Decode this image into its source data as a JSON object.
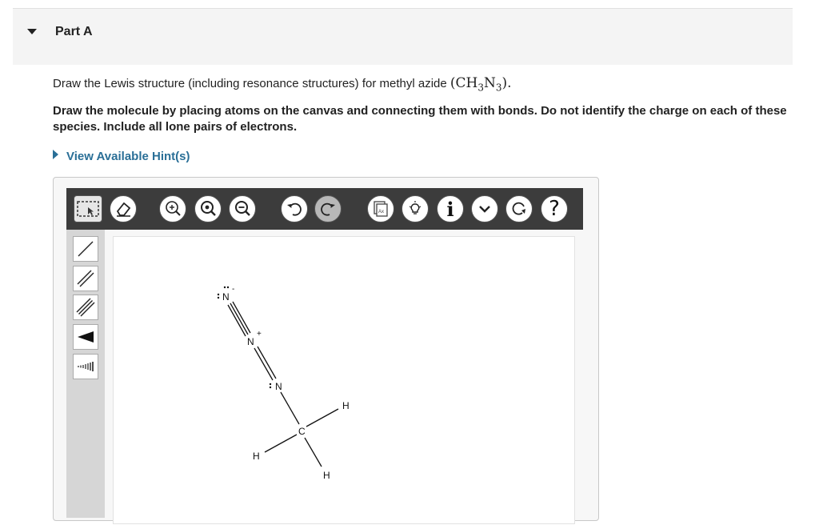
{
  "part": {
    "title": "Part A",
    "caret": "caret-down-icon"
  },
  "question": {
    "prompt_prefix": "Draw the Lewis structure (including resonance structures) for methyl azide ",
    "formula_open": "(CH",
    "formula_sub1": "3",
    "formula_mid": "N",
    "formula_sub2": "3",
    "formula_close": ").",
    "instructions": "Draw the molecule by placing atoms on the canvas and connecting them with bonds. Do not identify the charge on each of these species. Include all lone pairs of electrons.",
    "hint_label": "View Available Hint(s)"
  },
  "toolbar": {
    "buttons": [
      "select-icon",
      "eraser-icon",
      "zoom-fit-icon",
      "zoom-in-icon",
      "zoom-out-icon",
      "undo-icon",
      "redo-icon",
      "template-icon",
      "lightbulb-icon",
      "info-icon",
      "more-icon",
      "reset-icon",
      "help-icon"
    ],
    "info_glyph": "i",
    "help_glyph": "?"
  },
  "side_tools": [
    "single-bond-icon",
    "double-bond-icon",
    "triple-bond-icon",
    "wedge-bond-icon",
    "hash-bond-icon"
  ],
  "molecule": {
    "atoms": {
      "n_terminal": "N",
      "n_central": "N",
      "n_bonded": "N",
      "carbon": "C",
      "h_right": "H",
      "h_left": "H",
      "h_bottom": "H"
    },
    "charges": {
      "n_terminal": "-",
      "n_central": "+"
    }
  },
  "colors": {
    "toolbar_bg": "#3c3c3c",
    "link": "#2a6f97",
    "header_bg": "#f4f4f4"
  }
}
